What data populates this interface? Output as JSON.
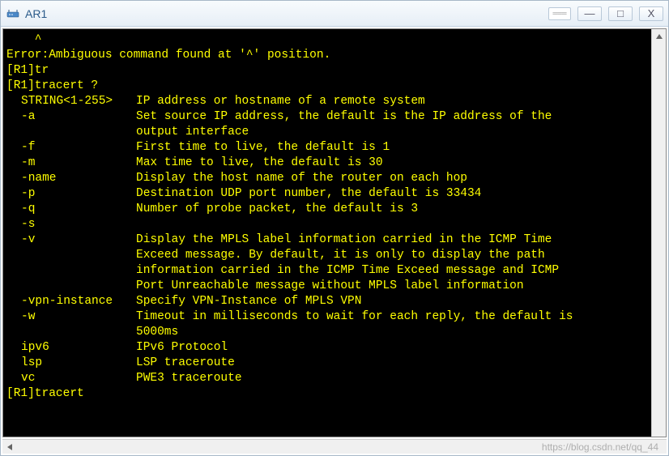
{
  "window": {
    "title": "AR1",
    "icon_name": "router-icon"
  },
  "terminal": {
    "caret_line": "    ^",
    "error_line": "Error:Ambiguous command found at '^' position.",
    "prompt1": "[R1]tr",
    "prompt2": "[R1]tracert ?",
    "options": [
      {
        "key": "STRING<1-255>",
        "desc": "IP address or hostname of a remote system"
      },
      {
        "key": "-a",
        "desc": "Set source IP address, the default is the IP address of the",
        "cont": [
          "output interface"
        ]
      },
      {
        "key": "-f",
        "desc": "First time to live, the default is 1"
      },
      {
        "key": "-m",
        "desc": "Max time to live, the default is 30"
      },
      {
        "key": "-name",
        "desc": "Display the host name of the router on each hop"
      },
      {
        "key": "-p",
        "desc": "Destination UDP port number, the default is 33434"
      },
      {
        "key": "-q",
        "desc": "Number of probe packet, the default is 3"
      },
      {
        "key": "-s",
        "desc": ""
      },
      {
        "key": "-v",
        "desc": "Display the MPLS label information carried in the ICMP Time",
        "cont": [
          "Exceed message. By default, it is only to display the path",
          "information carried in the ICMP Time Exceed message and ICMP",
          "Port Unreachable message without MPLS label information"
        ]
      },
      {
        "key": "-vpn-instance",
        "desc": "Specify VPN-Instance of MPLS VPN"
      },
      {
        "key": "-w",
        "desc": "Timeout in milliseconds to wait for each reply, the default is",
        "cont": [
          "5000ms"
        ]
      },
      {
        "key": "ipv6",
        "desc": "IPv6 Protocol"
      },
      {
        "key": "lsp",
        "desc": "LSP traceroute"
      },
      {
        "key": "vc",
        "desc": "PWE3 traceroute"
      }
    ],
    "prompt3": "[R1]tracert"
  },
  "watermark": "https://blog.csdn.net/qq_44"
}
